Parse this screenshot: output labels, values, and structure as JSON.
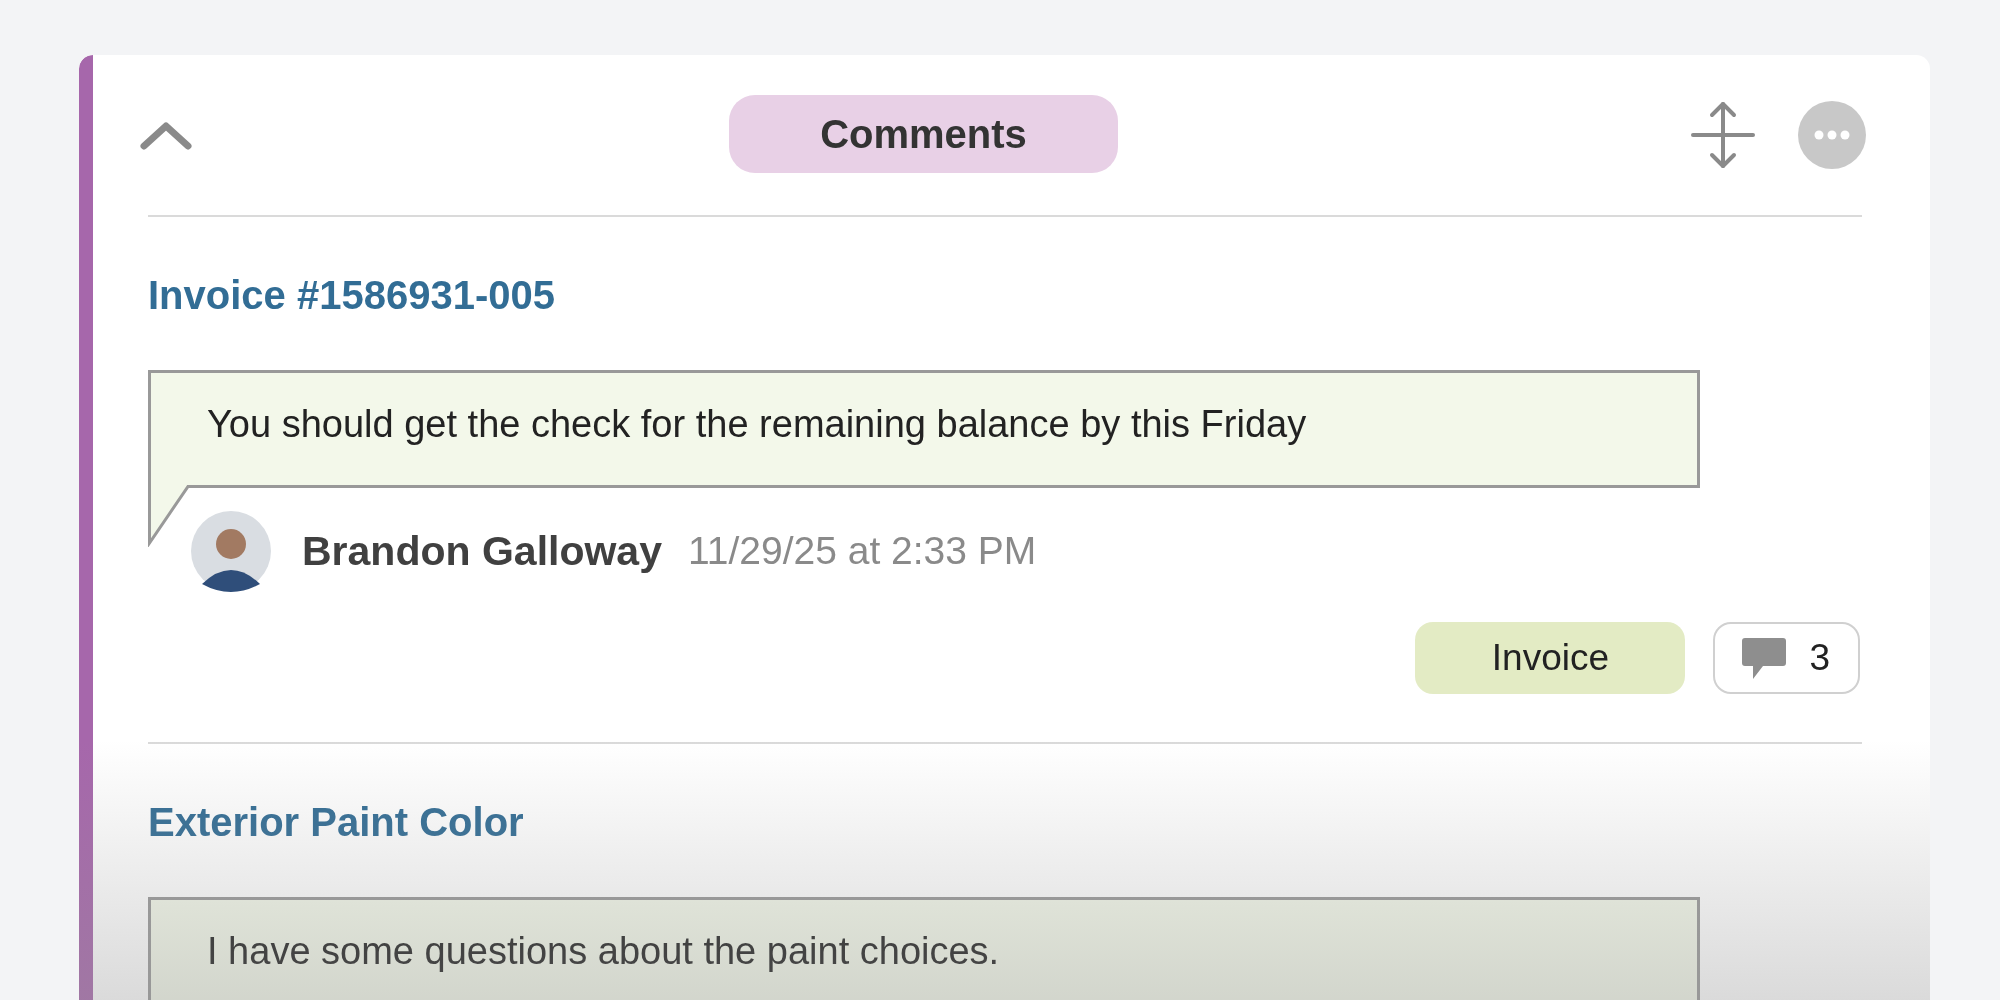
{
  "header": {
    "title": "Comments"
  },
  "comments": [
    {
      "title": "Invoice #1586931-005",
      "text": "You should get the check for the remaining balance by this Friday",
      "author": "Brandon Galloway",
      "timestamp": "11/29/25 at 2:33 PM",
      "tag": "Invoice",
      "reply_count": "3"
    },
    {
      "title": "Exterior Paint Color",
      "text": "I have some questions about the paint choices."
    }
  ]
}
